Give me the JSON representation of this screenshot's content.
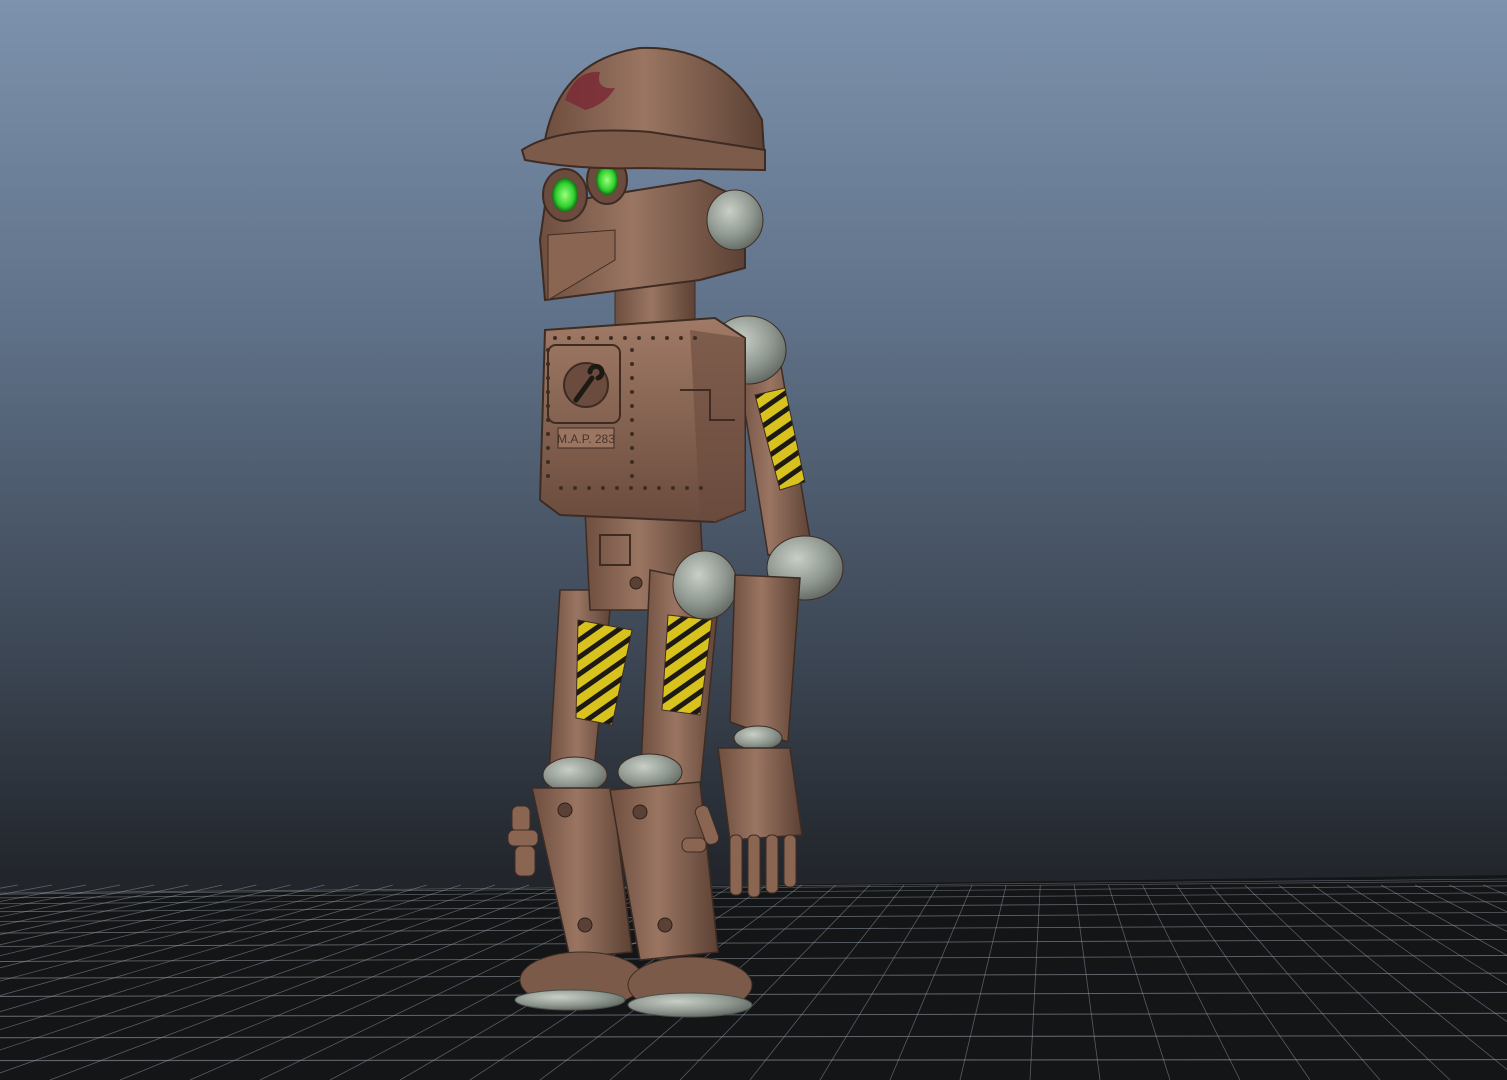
{
  "viewport": {
    "background_top": "#7d92ad",
    "background_bottom": "#141517",
    "grid_color": "#9aa3ad"
  },
  "model": {
    "chest_plate_text": "M.A.P. 283",
    "colors": {
      "body": "#8a6552",
      "body_shadow": "#5e4336",
      "body_highlight": "#a88470",
      "joint": "#9aa39c",
      "eye": "#39d83a",
      "hazard_yellow": "#d8c21e",
      "hazard_black": "#1d1a14",
      "helmet_logo": "#7a2a35"
    }
  }
}
